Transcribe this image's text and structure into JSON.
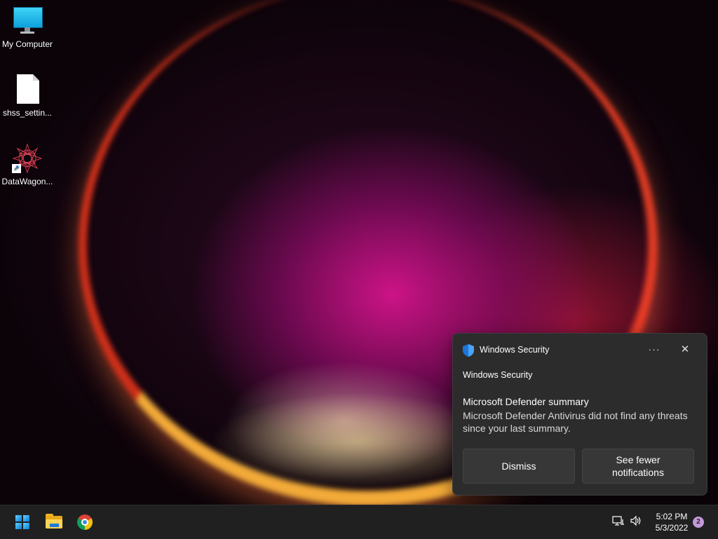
{
  "desktop": {
    "icons": [
      {
        "label": "My Computer",
        "icon": "monitor-icon"
      },
      {
        "label": "shss_settin...",
        "icon": "file-icon"
      },
      {
        "label": "DataWagon...",
        "icon": "mandala-icon"
      }
    ]
  },
  "toast": {
    "app_name": "Windows Security",
    "more_glyph": "···",
    "close_glyph": "✕",
    "attribution": "Windows Security",
    "title": "Microsoft Defender summary",
    "body": "Microsoft Defender Antivirus did not find any threats since your last summary.",
    "dismiss_label": "Dismiss",
    "fewer_label": "See fewer notifications"
  },
  "taskbar": {
    "pinned": [
      "start-icon",
      "file-explorer-icon",
      "chrome-icon"
    ],
    "time": "5:02 PM",
    "date": "5/3/2022",
    "notification_count": "2"
  },
  "colors": {
    "accent": "#0a78d7",
    "toast_bg": "#2c2c2c",
    "taskbar_bg": "#202020",
    "badge": "#c39ad9"
  }
}
